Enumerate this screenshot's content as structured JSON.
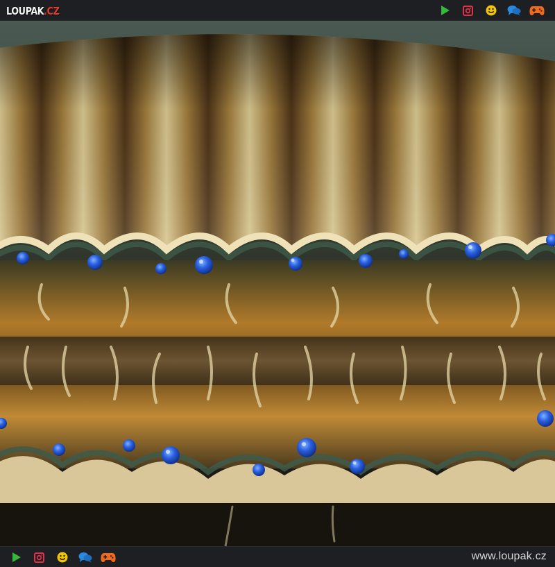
{
  "header": {
    "logo_name": "LOUPAK",
    "logo_tld": ".CZ",
    "icons": [
      "play-icon",
      "instagram-icon",
      "smiley-icon",
      "chat-icon",
      "gamepad-icon"
    ]
  },
  "photo": {
    "subject": "scallop-eyes"
  },
  "footer": {
    "icons": [
      "play-icon",
      "instagram-icon",
      "smiley-icon",
      "chat-icon",
      "gamepad-icon"
    ],
    "site_url": "www.loupak.cz"
  },
  "colors": {
    "bar_bg": "#1e1f22",
    "play": "#36b83a",
    "instagram": "#e0304a",
    "smiley": "#f2c50a",
    "chat": "#2a8ae0",
    "gamepad": "#f06a1c",
    "logo_tld": "#e33b2e",
    "scallop_eye": "#2a5fe0"
  }
}
